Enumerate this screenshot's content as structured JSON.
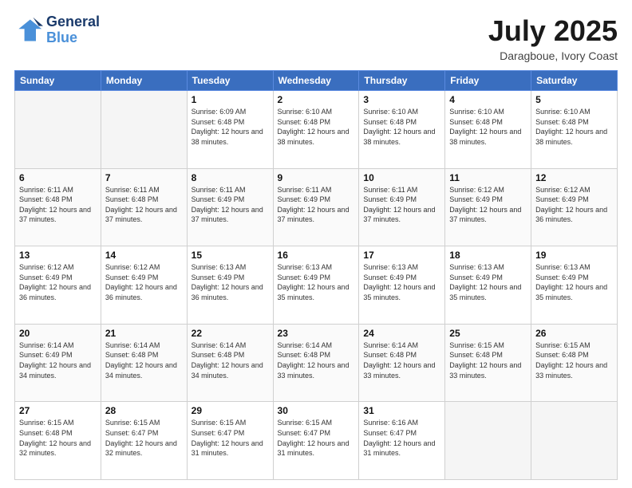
{
  "logo": {
    "line1": "General",
    "line2": "Blue"
  },
  "title": "July 2025",
  "subtitle": "Daragboue, Ivory Coast",
  "headers": [
    "Sunday",
    "Monday",
    "Tuesday",
    "Wednesday",
    "Thursday",
    "Friday",
    "Saturday"
  ],
  "weeks": [
    [
      {
        "day": "",
        "info": ""
      },
      {
        "day": "",
        "info": ""
      },
      {
        "day": "1",
        "info": "Sunrise: 6:09 AM\nSunset: 6:48 PM\nDaylight: 12 hours and 38 minutes."
      },
      {
        "day": "2",
        "info": "Sunrise: 6:10 AM\nSunset: 6:48 PM\nDaylight: 12 hours and 38 minutes."
      },
      {
        "day": "3",
        "info": "Sunrise: 6:10 AM\nSunset: 6:48 PM\nDaylight: 12 hours and 38 minutes."
      },
      {
        "day": "4",
        "info": "Sunrise: 6:10 AM\nSunset: 6:48 PM\nDaylight: 12 hours and 38 minutes."
      },
      {
        "day": "5",
        "info": "Sunrise: 6:10 AM\nSunset: 6:48 PM\nDaylight: 12 hours and 38 minutes."
      }
    ],
    [
      {
        "day": "6",
        "info": "Sunrise: 6:11 AM\nSunset: 6:48 PM\nDaylight: 12 hours and 37 minutes."
      },
      {
        "day": "7",
        "info": "Sunrise: 6:11 AM\nSunset: 6:48 PM\nDaylight: 12 hours and 37 minutes."
      },
      {
        "day": "8",
        "info": "Sunrise: 6:11 AM\nSunset: 6:49 PM\nDaylight: 12 hours and 37 minutes."
      },
      {
        "day": "9",
        "info": "Sunrise: 6:11 AM\nSunset: 6:49 PM\nDaylight: 12 hours and 37 minutes."
      },
      {
        "day": "10",
        "info": "Sunrise: 6:11 AM\nSunset: 6:49 PM\nDaylight: 12 hours and 37 minutes."
      },
      {
        "day": "11",
        "info": "Sunrise: 6:12 AM\nSunset: 6:49 PM\nDaylight: 12 hours and 37 minutes."
      },
      {
        "day": "12",
        "info": "Sunrise: 6:12 AM\nSunset: 6:49 PM\nDaylight: 12 hours and 36 minutes."
      }
    ],
    [
      {
        "day": "13",
        "info": "Sunrise: 6:12 AM\nSunset: 6:49 PM\nDaylight: 12 hours and 36 minutes."
      },
      {
        "day": "14",
        "info": "Sunrise: 6:12 AM\nSunset: 6:49 PM\nDaylight: 12 hours and 36 minutes."
      },
      {
        "day": "15",
        "info": "Sunrise: 6:13 AM\nSunset: 6:49 PM\nDaylight: 12 hours and 36 minutes."
      },
      {
        "day": "16",
        "info": "Sunrise: 6:13 AM\nSunset: 6:49 PM\nDaylight: 12 hours and 35 minutes."
      },
      {
        "day": "17",
        "info": "Sunrise: 6:13 AM\nSunset: 6:49 PM\nDaylight: 12 hours and 35 minutes."
      },
      {
        "day": "18",
        "info": "Sunrise: 6:13 AM\nSunset: 6:49 PM\nDaylight: 12 hours and 35 minutes."
      },
      {
        "day": "19",
        "info": "Sunrise: 6:13 AM\nSunset: 6:49 PM\nDaylight: 12 hours and 35 minutes."
      }
    ],
    [
      {
        "day": "20",
        "info": "Sunrise: 6:14 AM\nSunset: 6:49 PM\nDaylight: 12 hours and 34 minutes."
      },
      {
        "day": "21",
        "info": "Sunrise: 6:14 AM\nSunset: 6:48 PM\nDaylight: 12 hours and 34 minutes."
      },
      {
        "day": "22",
        "info": "Sunrise: 6:14 AM\nSunset: 6:48 PM\nDaylight: 12 hours and 34 minutes."
      },
      {
        "day": "23",
        "info": "Sunrise: 6:14 AM\nSunset: 6:48 PM\nDaylight: 12 hours and 33 minutes."
      },
      {
        "day": "24",
        "info": "Sunrise: 6:14 AM\nSunset: 6:48 PM\nDaylight: 12 hours and 33 minutes."
      },
      {
        "day": "25",
        "info": "Sunrise: 6:15 AM\nSunset: 6:48 PM\nDaylight: 12 hours and 33 minutes."
      },
      {
        "day": "26",
        "info": "Sunrise: 6:15 AM\nSunset: 6:48 PM\nDaylight: 12 hours and 33 minutes."
      }
    ],
    [
      {
        "day": "27",
        "info": "Sunrise: 6:15 AM\nSunset: 6:48 PM\nDaylight: 12 hours and 32 minutes."
      },
      {
        "day": "28",
        "info": "Sunrise: 6:15 AM\nSunset: 6:47 PM\nDaylight: 12 hours and 32 minutes."
      },
      {
        "day": "29",
        "info": "Sunrise: 6:15 AM\nSunset: 6:47 PM\nDaylight: 12 hours and 31 minutes."
      },
      {
        "day": "30",
        "info": "Sunrise: 6:15 AM\nSunset: 6:47 PM\nDaylight: 12 hours and 31 minutes."
      },
      {
        "day": "31",
        "info": "Sunrise: 6:16 AM\nSunset: 6:47 PM\nDaylight: 12 hours and 31 minutes."
      },
      {
        "day": "",
        "info": ""
      },
      {
        "day": "",
        "info": ""
      }
    ]
  ]
}
